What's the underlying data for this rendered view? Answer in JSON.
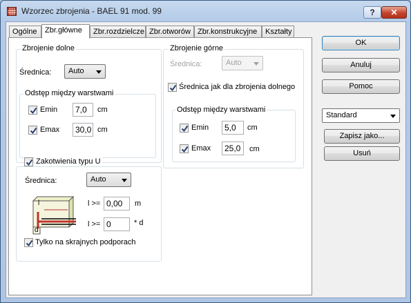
{
  "window": {
    "title": "Wzorzec zbrojenia - BAEL 91 mod. 99",
    "help_label": "?",
    "close_label": "✕"
  },
  "tabs": [
    {
      "label": "Ogólne"
    },
    {
      "label": "Zbr.główne"
    },
    {
      "label": "Zbr.rozdzielcze"
    },
    {
      "label": "Zbr.otworów"
    },
    {
      "label": "Zbr.konstrukcyjne"
    },
    {
      "label": "Kształty"
    }
  ],
  "bottom_reinf": {
    "title": "Zbrojenie dolne",
    "diameter_label": "Średnica:",
    "diameter_value": "Auto",
    "spacing": {
      "title": "Odstęp między warstwami",
      "emin_label": "Emin",
      "emin_value": "7,0",
      "emin_unit": "cm",
      "emin_checked": true,
      "emax_label": "Emax",
      "emax_value": "30,0",
      "emax_unit": "cm",
      "emax_checked": true
    }
  },
  "anchorage": {
    "title": "Zakotwienia typu U",
    "checked": true,
    "diameter_label": "Średnica:",
    "diameter_value": "Auto",
    "l_label": "l >=",
    "l_value": "0,00",
    "l_unit": "m",
    "d_label": "l >=",
    "d_value": "0",
    "d_unit": "* d",
    "diagram_l": "l",
    "diagram_d": "d",
    "edge_label": "Tylko na skrajnych podporach",
    "edge_checked": true
  },
  "top_reinf": {
    "title": "Zbrojenie górne",
    "diameter_label": "Średnica:",
    "diameter_value": "Auto",
    "same_label": "Średnica jak dla zbrojenia dolnego",
    "same_checked": true,
    "spacing": {
      "title": "Odstęp między warstwami",
      "emin_label": "Emin",
      "emin_value": "5,0",
      "emin_unit": "cm",
      "emin_checked": true,
      "emax_label": "Emax",
      "emax_value": "25,0",
      "emax_unit": "cm",
      "emax_checked": true
    }
  },
  "buttons": {
    "ok": "OK",
    "cancel": "Anuluj",
    "help": "Pomoc",
    "save_as": "Zapisz jako...",
    "delete": "Usuń"
  },
  "preset": {
    "value": "Standard"
  },
  "colors": {
    "check": "#2a3f6e",
    "diagram_red": "#c0322a",
    "diagram_fill": "#eef0c8"
  }
}
